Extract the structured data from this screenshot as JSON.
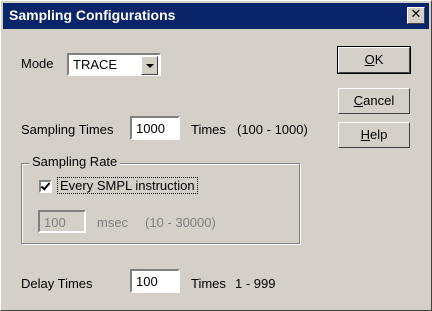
{
  "window": {
    "title": "Sampling Configurations",
    "close_glyph": "✕"
  },
  "mode": {
    "label": "Mode",
    "value": "TRACE"
  },
  "sampling_times": {
    "label": "Sampling Times",
    "value": "1000",
    "unit": "Times",
    "range": "(100 - 1000)"
  },
  "sampling_rate": {
    "group_title": "Sampling Rate",
    "checkbox_label": "Every SMPL instruction",
    "checked": true,
    "msec_value": "100",
    "msec_unit": "msec",
    "msec_range": "(10 - 30000)"
  },
  "delay_times": {
    "label": "Delay Times",
    "value": "100",
    "unit": "Times",
    "range": "1 - 999"
  },
  "buttons": {
    "ok_pre": "",
    "ok_mnem": "O",
    "ok_post": "K",
    "cancel_mnem": "C",
    "cancel_post": "ancel",
    "help_mnem": "H",
    "help_post": "elp"
  }
}
